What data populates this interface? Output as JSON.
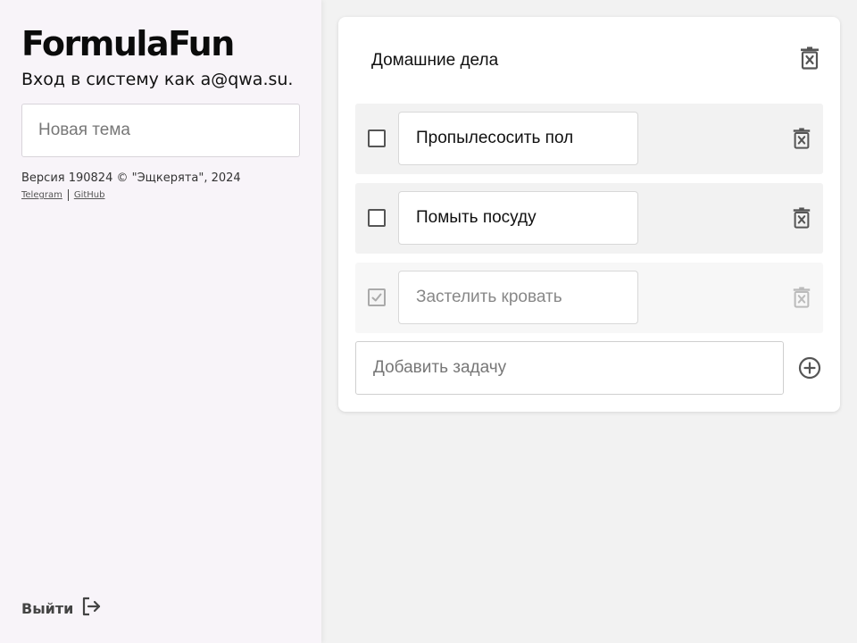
{
  "app": {
    "brand": "FormulaFun",
    "login_text": "Вход в систему как a@qwa.su."
  },
  "sidebar": {
    "new_topic_placeholder": "Новая тема",
    "version_text": "Версия 190824 © \"Эщкерята\", 2024",
    "links": [
      {
        "label": "Telegram"
      },
      {
        "label": "GitHub"
      }
    ],
    "logout_label": "Выйти",
    "logout_icon": "logout-icon"
  },
  "card": {
    "title": "Домашние дела",
    "delete_icon": "trash-icon",
    "tasks": [
      {
        "text": "Пропылесосить пол",
        "done": false
      },
      {
        "text": "Помыть посуду",
        "done": false
      },
      {
        "text": "Застелить кровать",
        "done": true
      }
    ],
    "add_placeholder": "Добавить задачу",
    "add_icon": "plus-circle-icon"
  },
  "colors": {
    "sidebar_bg": "#f8f4f9",
    "main_bg": "#f2f2f2",
    "card_bg": "#ffffff",
    "task_bg": "#f2f2f2",
    "icon_dark": "#555555",
    "icon_muted": "#aaaaaa"
  }
}
